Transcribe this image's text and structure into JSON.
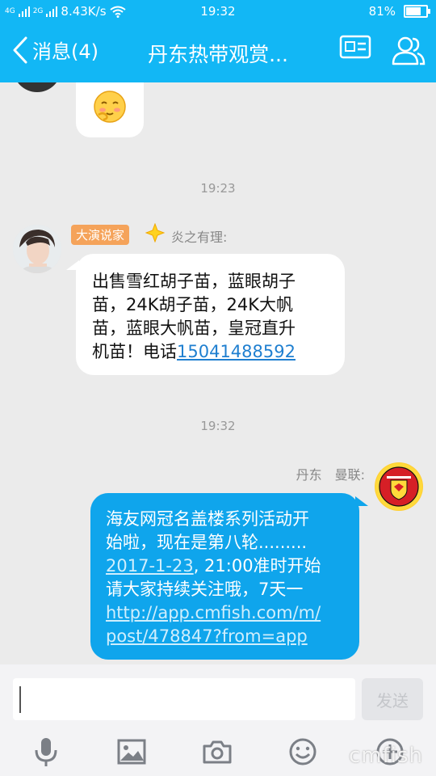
{
  "status": {
    "network_left": "4G",
    "network_right": "2G",
    "speed": "8.43K/s",
    "time": "19:32",
    "battery": "81%",
    "battery_level": 0.81
  },
  "nav": {
    "back_label": "消息(4)",
    "title": "丹东热带观赏..."
  },
  "messages": {
    "time1": "19:23",
    "msg1": {
      "badge": "大演说家",
      "sender": "炎之有理:",
      "text_lines": [
        "出售雪红胡子苗，蓝眼胡子",
        "苗，24K胡子苗，24K大帆",
        "苗，蓝眼大帆苗，皇冠直升"
      ],
      "last_prefix": "机苗！电话",
      "phone": "15041488592"
    },
    "time2": "19:32",
    "msg2": {
      "sender": "丹东　曼联:",
      "line1": "海友网冠名盖楼系列活动开",
      "line2": "始啦，现在是第八轮.........",
      "date_link": "2017-1-23",
      "line3_rest": ", 21:00准时开始",
      "line4": "请大家持续关注哦，7天一",
      "url1": "http://app.cmfish.com/m/",
      "url2": "post/478847?from=app"
    }
  },
  "input": {
    "placeholder": "",
    "send_label": "发送"
  },
  "watermark": "cmfish",
  "colors": {
    "accent": "#12b7f5",
    "bubble_right": "#0fa5ec",
    "badge": "#f5a35a"
  }
}
